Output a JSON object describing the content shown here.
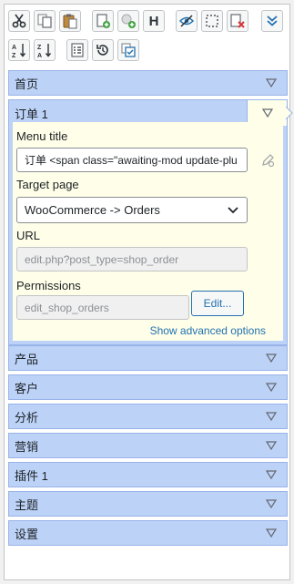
{
  "toolbar": {
    "buttons": [
      {
        "icon": "cut-icon"
      },
      {
        "icon": "copy-icon"
      },
      {
        "icon": "paste-icon"
      },
      {
        "icon": "new-menu-icon"
      },
      {
        "icon": "new-submenu-icon"
      },
      {
        "icon": "heading-icon",
        "text": "H"
      },
      {
        "icon": "hide-icon"
      },
      {
        "icon": "separator-icon"
      },
      {
        "icon": "delete-icon"
      },
      {
        "icon": "expand-icon"
      },
      {
        "icon": "sort-az-icon",
        "text": "A↓Z"
      },
      {
        "icon": "sort-za-icon",
        "text": "Z↓A"
      },
      {
        "icon": "list-icon"
      },
      {
        "icon": "reset-icon"
      },
      {
        "icon": "copy-permissions-icon"
      }
    ]
  },
  "menu": {
    "items_before": [
      {
        "label": "首页"
      }
    ],
    "open_item": {
      "label": "订单 1",
      "menu_title_label": "Menu title",
      "menu_title_value": "订单 <span class=\"awaiting-mod update-plu",
      "target_page_label": "Target page",
      "target_page_value": "WooCommerce -> Orders",
      "url_label": "URL",
      "url_value": "edit.php?post_type=shop_order",
      "permissions_label": "Permissions",
      "permissions_value": "edit_shop_orders",
      "edit_button": "Edit...",
      "advanced_link": "Show advanced options"
    },
    "items_after": [
      {
        "label": "产品"
      },
      {
        "label": "客户"
      },
      {
        "label": "分析"
      },
      {
        "label": "营销"
      },
      {
        "label": "插件 1"
      },
      {
        "label": "主题"
      },
      {
        "label": "设置"
      }
    ]
  },
  "colors": {
    "item_bg": "#bdd2f7",
    "item_border": "#98b3e8",
    "editor_bg": "#fffee8",
    "link": "#2271b1"
  }
}
